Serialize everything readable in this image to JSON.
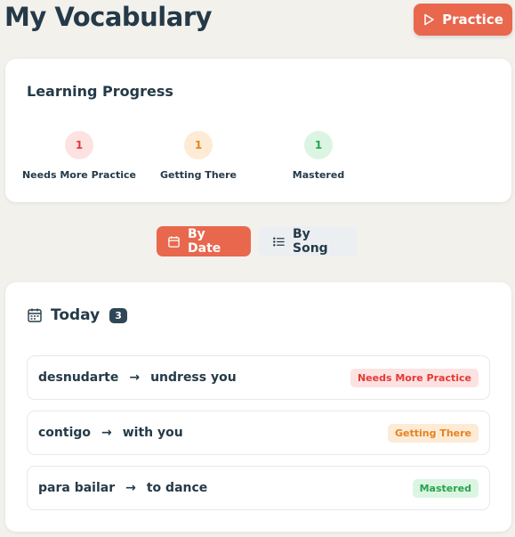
{
  "header": {
    "title": "My Vocabulary",
    "practice_label": "Practice"
  },
  "progress": {
    "title": "Learning Progress",
    "stats": [
      {
        "count": "1",
        "label": "Needs More Practice"
      },
      {
        "count": "1",
        "label": "Getting There"
      },
      {
        "count": "1",
        "label": "Mastered"
      }
    ]
  },
  "view_toggle": {
    "by_date": "By Date",
    "by_song": "By Song",
    "selected": "By Date"
  },
  "today": {
    "title": "Today",
    "count": "3",
    "words": [
      {
        "spanish": "desnudarte",
        "arrow": "→",
        "english": "undress you",
        "status": "Needs More Practice"
      },
      {
        "spanish": "contigo",
        "arrow": "→",
        "english": "with you",
        "status": "Getting There"
      },
      {
        "spanish": "para bailar",
        "arrow": "→",
        "english": "to dance",
        "status": "Mastered"
      }
    ]
  },
  "colors": {
    "accent": "#e8674d",
    "text": "#253a48",
    "needs_practice": "#e53935",
    "getting_there": "#e5821f",
    "mastered": "#27a34c"
  },
  "icons": {
    "practice": "play-icon",
    "by_date": "calendar-icon",
    "by_song": "list-icon",
    "today": "calendar-icon"
  }
}
